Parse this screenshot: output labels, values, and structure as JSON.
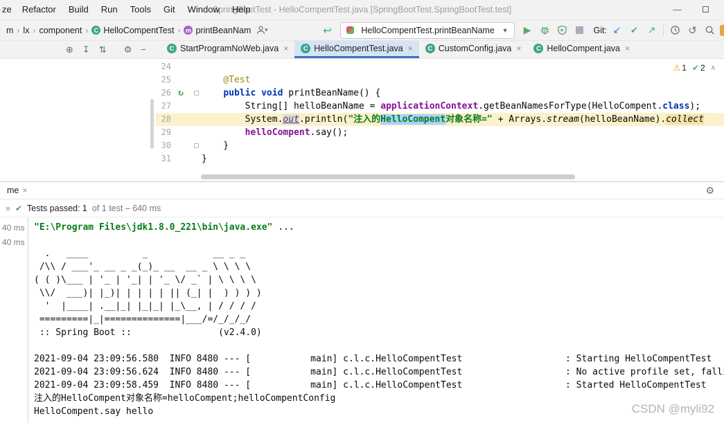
{
  "titlebar": {
    "menu_items": [
      "ze",
      "Refactor",
      "Build",
      "Run",
      "Tools",
      "Git",
      "Window",
      "Help"
    ],
    "title": "SpringBootTest - HelloCompentTest.java [SpringBootTest.SpringBootTest.test]"
  },
  "navbar": {
    "breadcrumbs": [
      {
        "label": "m",
        "icon": ""
      },
      {
        "label": "lx",
        "icon": ""
      },
      {
        "label": "component",
        "icon": ""
      },
      {
        "label": "HelloCompentTest",
        "icon": "class"
      },
      {
        "label": "printBeanNam",
        "icon": "method"
      }
    ],
    "run_config": "HelloCompentTest.printBeanName",
    "git_label": "Git:"
  },
  "editor_tabs": [
    {
      "label": "StartProgramNoWeb.java",
      "active": false
    },
    {
      "label": "HelloCompentTest.java",
      "active": true
    },
    {
      "label": "CustomConfig.java",
      "active": false
    },
    {
      "label": "HelloCompent.java",
      "active": false
    }
  ],
  "editor": {
    "inspection_warnings": "1",
    "inspection_typos": "2",
    "code_lines": [
      {
        "num": "24",
        "tokens": []
      },
      {
        "num": "25",
        "tokens": [
          {
            "t": "    @Test",
            "c": "ann"
          }
        ]
      },
      {
        "num": "26",
        "gutter": "run",
        "fold": true,
        "tokens": [
          {
            "t": "    ",
            "c": "p"
          },
          {
            "t": "public void",
            "c": "kw"
          },
          {
            "t": " printBeanName() {",
            "c": "p"
          }
        ]
      },
      {
        "num": "27",
        "tokens": [
          {
            "t": "        String[] helloBeanName = ",
            "c": "p"
          },
          {
            "t": "applicationContext",
            "c": "field"
          },
          {
            "t": ".getBeanNamesForType(HelloCompent.",
            "c": "p"
          },
          {
            "t": "class",
            "c": "kw"
          },
          {
            "t": ");",
            "c": "p"
          }
        ]
      },
      {
        "num": "28",
        "highlight": true,
        "tokens": [
          {
            "t": "        System.",
            "c": "p"
          },
          {
            "t": "out",
            "c": "sfield hl"
          },
          {
            "t": ".println(",
            "c": "p"
          },
          {
            "t": "\"注入的",
            "c": "str"
          },
          {
            "t": "HelloCompent",
            "c": "str sel"
          },
          {
            "t": "对象名称=\"",
            "c": "str"
          },
          {
            "t": " + Arrays.",
            "c": "p"
          },
          {
            "t": "stream",
            "c": "smethod"
          },
          {
            "t": "(helloBeanName).",
            "c": "p"
          },
          {
            "t": "collect",
            "c": "warn"
          }
        ]
      },
      {
        "num": "29",
        "tokens": [
          {
            "t": "        ",
            "c": "p"
          },
          {
            "t": "helloCompent",
            "c": "field"
          },
          {
            "t": ".say();",
            "c": "p"
          }
        ]
      },
      {
        "num": "30",
        "fold": true,
        "tokens": [
          {
            "t": "    }",
            "c": "p"
          }
        ]
      },
      {
        "num": "31",
        "tokens": [
          {
            "t": "}",
            "c": "p"
          }
        ]
      }
    ]
  },
  "run_panel": {
    "tab_label": "me",
    "status_main": "Tests passed: 1",
    "status_detail": "of 1 test – 640 ms",
    "tree_durations": [
      "40 ms",
      "40 ms"
    ],
    "console_lines": [
      {
        "c": "cmd",
        "t": "\"E:\\Program Files\\jdk1.8.0_221\\bin\\java.exe\" ..."
      },
      {
        "c": "p",
        "t": ""
      },
      {
        "c": "p",
        "t": "  .   ____          _            __ _ _"
      },
      {
        "c": "p",
        "t": " /\\\\ / ___'_ __ _ _(_)_ __  __ _ \\ \\ \\ \\"
      },
      {
        "c": "p",
        "t": "( ( )\\___ | '_ | '_| | '_ \\/ _` | \\ \\ \\ \\"
      },
      {
        "c": "p",
        "t": " \\\\/  ___)| |_)| | | | | || (_| |  ) ) ) )"
      },
      {
        "c": "p",
        "t": "  '  |____| .__|_| |_|_| |_\\__, | / / / /"
      },
      {
        "c": "p",
        "t": " =========|_|==============|___/=/_/_/_/"
      },
      {
        "c": "p",
        "t": " :: Spring Boot ::                (v2.4.0)"
      },
      {
        "c": "p",
        "t": ""
      },
      {
        "c": "p",
        "t": "2021-09-04 23:09:56.580  INFO 8480 --- [           main] c.l.c.HelloCompentTest                   : Starting HelloCompentTest"
      },
      {
        "c": "p",
        "t": "2021-09-04 23:09:56.624  INFO 8480 --- [           main] c.l.c.HelloCompentTest                   : No active profile set, falling back to default profiles: default"
      },
      {
        "c": "p",
        "t": "2021-09-04 23:09:58.459  INFO 8480 --- [           main] c.l.c.HelloCompentTest                   : Started HelloCompentTest"
      },
      {
        "c": "p",
        "t": "注入的HelloCompent对象名称=helloCompent;helloCompentConfig"
      },
      {
        "c": "p",
        "t": "HelloCompent.say hello"
      }
    ]
  },
  "watermark": "CSDN @myli92"
}
